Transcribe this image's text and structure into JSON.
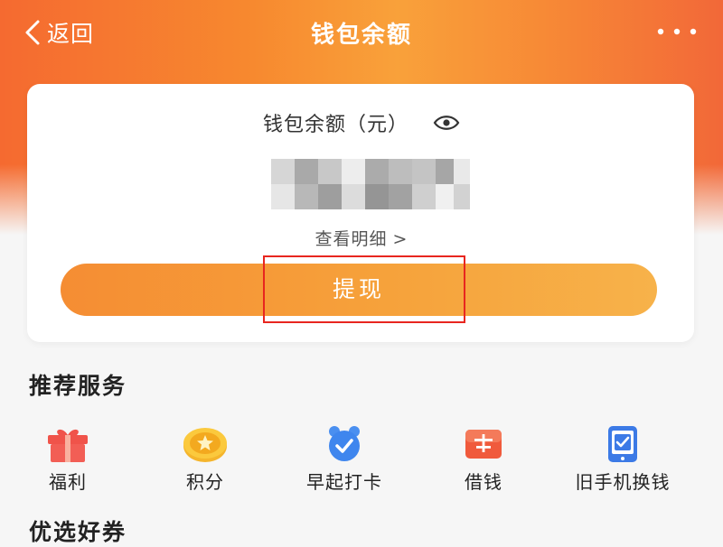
{
  "header": {
    "back_label": "返回",
    "title": "钱包余额",
    "more_icon": "more-dots-icon"
  },
  "balance": {
    "label": "钱包余额（元）",
    "visibility_icon": "eye-icon",
    "amount_state": "pixelated",
    "detail_link": "查看明细",
    "detail_arrow": ">"
  },
  "withdraw": {
    "label": "提现",
    "highlight_color": "#e8261f"
  },
  "services": {
    "title": "推荐服务",
    "items": [
      {
        "label": "福利",
        "icon": "gift-icon"
      },
      {
        "label": "积分",
        "icon": "coin-icon"
      },
      {
        "label": "早起打卡",
        "icon": "alarm-clock-icon"
      },
      {
        "label": "借钱",
        "icon": "borrow-icon"
      },
      {
        "label": "旧手机换钱",
        "icon": "phone-recycle-icon"
      }
    ]
  },
  "coupons": {
    "title": "优选好券"
  },
  "colors": {
    "brand_orange": "#f7892f",
    "button_orange": "#f6a23b",
    "highlight_red": "#e8261f"
  }
}
